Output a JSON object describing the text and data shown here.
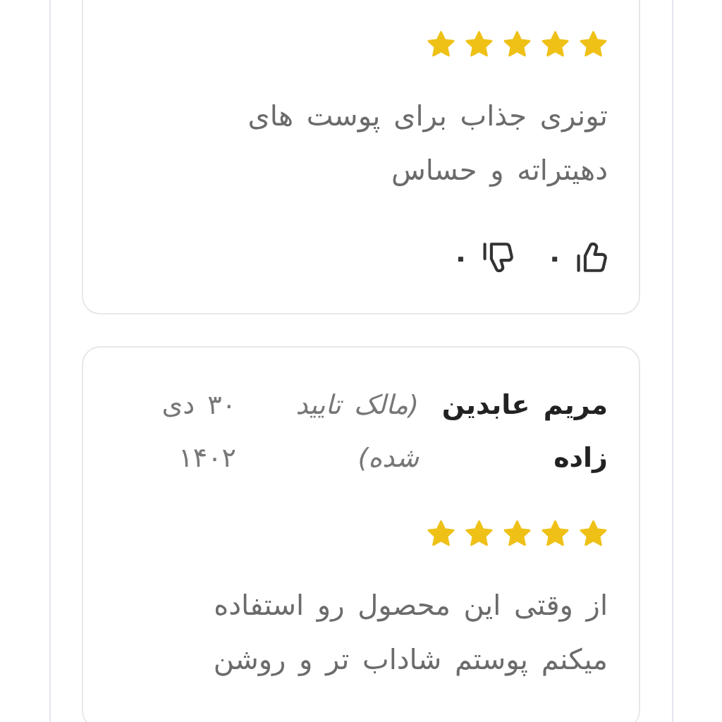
{
  "reviews": [
    {
      "stars": 5,
      "text": "تونری جذاب برای پوست های دهیتراته و حساس",
      "likes": "۰",
      "dislikes": "۰"
    },
    {
      "author": "مریم عابدین زاده",
      "badge": "(مالک تایید شده)",
      "date": "۳۰ دی ۱۴۰۲",
      "stars": 5,
      "text": "از وقتی این محصول رو استفاده میکنم پوستم شاداب تر و روشن"
    }
  ]
}
